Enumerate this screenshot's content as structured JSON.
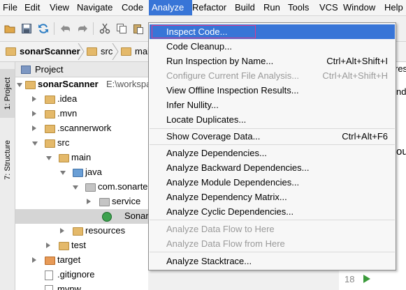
{
  "menubar": {
    "items": [
      "File",
      "Edit",
      "View",
      "Navigate",
      "Code",
      "Analyze",
      "Refactor",
      "Build",
      "Run",
      "Tools",
      "VCS",
      "Window",
      "Help"
    ],
    "active": "Analyze"
  },
  "toolbar": {
    "icons": [
      "folder-open-icon",
      "save-icon",
      "sync-icon",
      "undo-icon",
      "redo-icon",
      "cut-icon",
      "copy-icon",
      "paste-icon"
    ]
  },
  "breadcrumb": [
    "sonarScanner",
    "src",
    "mai"
  ],
  "tool_strip": {
    "project_tab": "1: Project",
    "structure_tab": "7: Structure"
  },
  "project_panel": {
    "title": "Project",
    "rows": [
      {
        "label": "sonarScanner",
        "extra": "E:\\workspa"
      },
      {
        "label": ".idea"
      },
      {
        "label": ".mvn"
      },
      {
        "label": ".scannerwork"
      },
      {
        "label": "src"
      },
      {
        "label": "main"
      },
      {
        "label": "java"
      },
      {
        "label": "com.sonarte"
      },
      {
        "label": "service"
      },
      {
        "label": "Sonar"
      },
      {
        "label": "resources"
      },
      {
        "label": "test"
      },
      {
        "label": "target"
      },
      {
        "label": ".gitignore"
      },
      {
        "label": "mvnw"
      }
    ]
  },
  "editor": {
    "fragments": [
      "rest",
      "nde",
      "oul"
    ],
    "line_number": "18"
  },
  "analyze_menu": {
    "items": [
      {
        "label": "Inspect Code...",
        "shortcut": ""
      },
      {
        "label": "Code Cleanup...",
        "shortcut": ""
      },
      {
        "label": "Run Inspection by Name...",
        "shortcut": "Ctrl+Alt+Shift+I"
      },
      {
        "label": "Configure Current File Analysis...",
        "shortcut": "Ctrl+Alt+Shift+H"
      },
      {
        "label": "View Offline Inspection Results...",
        "shortcut": ""
      },
      {
        "label": "Infer Nullity...",
        "shortcut": ""
      },
      {
        "label": "Locate Duplicates...",
        "shortcut": ""
      },
      {
        "label": "Show Coverage Data...",
        "shortcut": "Ctrl+Alt+F6"
      },
      {
        "label": "Analyze Dependencies...",
        "shortcut": ""
      },
      {
        "label": "Analyze Backward Dependencies...",
        "shortcut": ""
      },
      {
        "label": "Analyze Module Dependencies...",
        "shortcut": ""
      },
      {
        "label": "Analyze Dependency Matrix...",
        "shortcut": ""
      },
      {
        "label": "Analyze Cyclic Dependencies...",
        "shortcut": ""
      },
      {
        "label": "Analyze Data Flow to Here",
        "shortcut": ""
      },
      {
        "label": "Analyze Data Flow from Here",
        "shortcut": ""
      },
      {
        "label": "Analyze Stacktrace...",
        "shortcut": ""
      }
    ]
  },
  "colors": {
    "accent": "#3875d7",
    "focus_outline": "#e0388b",
    "folder": "#e4b96a",
    "folder_orange": "#e79a57"
  }
}
